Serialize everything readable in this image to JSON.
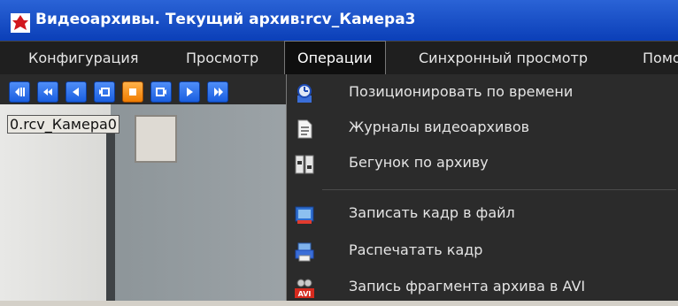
{
  "window": {
    "title": "Видеоархивы. Текущий архив:rcv_Камера3"
  },
  "menubar": {
    "items": [
      {
        "label": "Конфигурация"
      },
      {
        "label": "Просмотр"
      },
      {
        "label": "Операции"
      },
      {
        "label": "Синхронный просмотр"
      },
      {
        "label": "Помо"
      }
    ]
  },
  "toolbar": {
    "buttons": [
      "frame-step-icon",
      "rewind-fast-icon",
      "prev-icon",
      "frame-back-icon",
      "stop-icon",
      "frame-forward-icon",
      "play-icon",
      "more-icon"
    ],
    "active_button": "stop-icon"
  },
  "video": {
    "camera_label": "0.rcv_Камера0"
  },
  "operations_menu": {
    "items": [
      {
        "label": "Позиционировать по времени",
        "icon": "clock-icon"
      },
      {
        "label": "Журналы видеоархивов",
        "icon": "document-icon"
      },
      {
        "label": "Бегунок по архиву",
        "icon": "slider-icon"
      },
      {
        "label": "Записать кадр в файл",
        "icon": "save-frame-icon"
      },
      {
        "label": "Распечатать кадр",
        "icon": "print-icon"
      },
      {
        "label": "Запись фрагмента архива в AVI",
        "icon": "avi-icon"
      }
    ]
  },
  "colors": {
    "titlebar": "#0b3fb8",
    "menubar": "#1f1f1f",
    "menu_bg": "#2b2b2b",
    "active_button": "#f07c00"
  }
}
